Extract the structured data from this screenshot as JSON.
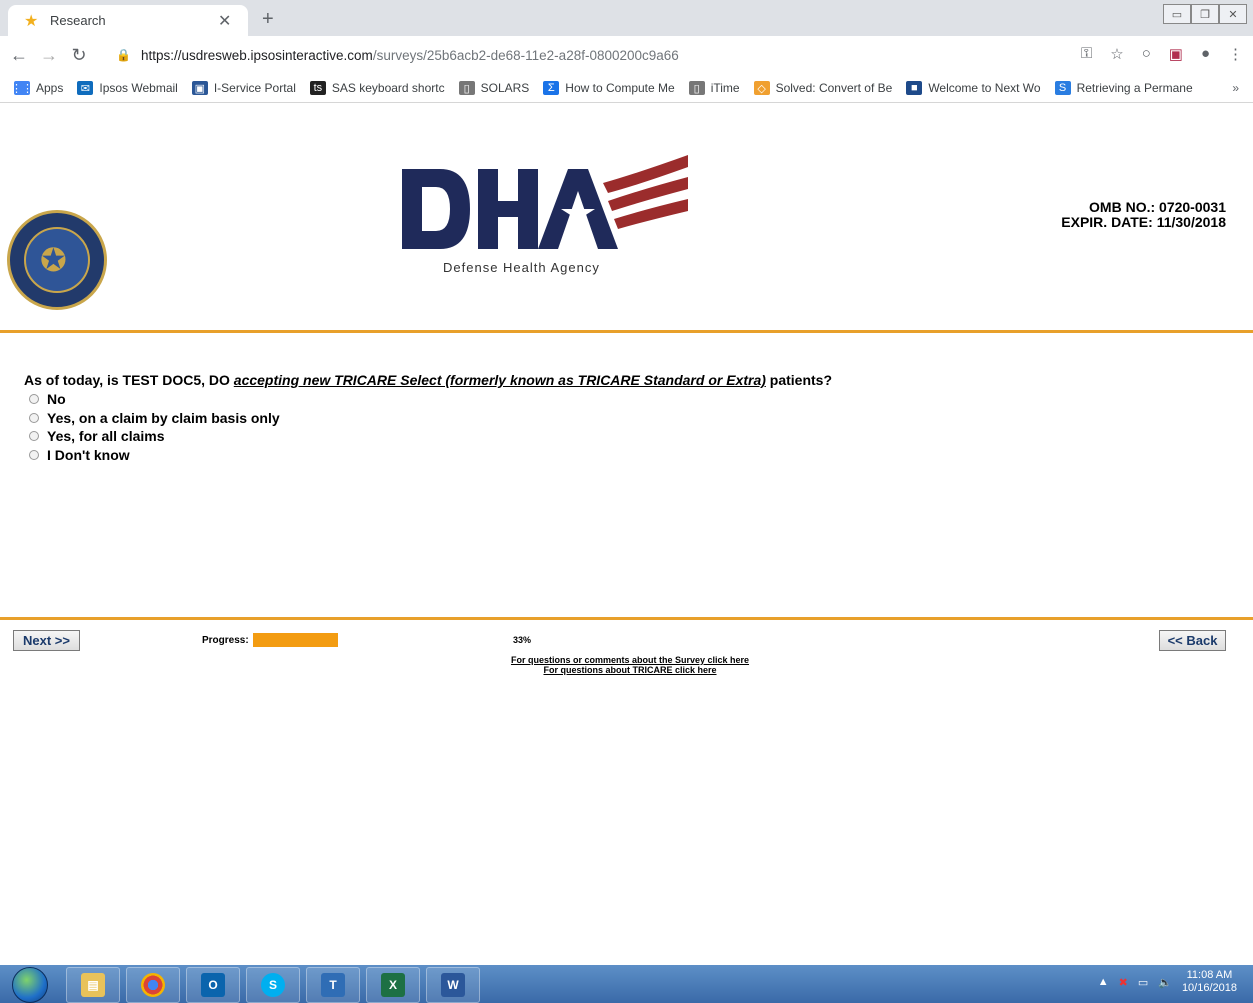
{
  "browser": {
    "tab_title": "Research",
    "url_host": "https://usdresweb.ipsosinteractive.com",
    "url_path": "/surveys/25b6acb2-de68-11e2-a28f-0800200c9a66",
    "bookmarks": [
      {
        "label": "Apps",
        "icon": "apps-grid-icon",
        "color": "#4285f4"
      },
      {
        "label": "Ipsos Webmail",
        "icon": "mail-icon",
        "color": "#0f6cbd"
      },
      {
        "label": "I-Service Portal",
        "icon": "portal-icon",
        "color": "#2b5797"
      },
      {
        "label": "SAS keyboard shortc",
        "icon": "ts-icon",
        "color": "#222"
      },
      {
        "label": "SOLARS",
        "icon": "page-icon",
        "color": "#777"
      },
      {
        "label": "How to Compute Me",
        "icon": "sigma-icon",
        "color": "#1a73e8"
      },
      {
        "label": "iTime",
        "icon": "page-icon",
        "color": "#777"
      },
      {
        "label": "Solved: Convert of Be",
        "icon": "chat-icon",
        "color": "#f0a030"
      },
      {
        "label": "Welcome to Next Wo",
        "icon": "next-icon",
        "color": "#1e4a8a"
      },
      {
        "label": "Retrieving a Permane",
        "icon": "s-icon",
        "color": "#2a7de1"
      }
    ],
    "overflow": "»"
  },
  "header": {
    "logo_caption": "Defense Health Agency",
    "omb_no": "OMB NO.: 0720-0031",
    "expir_date": "EXPIR. DATE: 11/30/2018"
  },
  "question": {
    "prefix": "As of today, is TEST DOC5, DO ",
    "emphasis": "accepting new TRICARE Select (formerly known as TRICARE Standard or Extra)",
    "suffix": " patients?",
    "options": [
      "No",
      "Yes, on a claim by claim basis only",
      "Yes, for all claims",
      "I Don't know"
    ]
  },
  "footer": {
    "next_label": "Next >>",
    "back_label": "<< Back",
    "progress_label": "Progress:",
    "progress_value": 0.33,
    "progress_text": "33%",
    "link_survey": "For questions or comments about the Survey click here",
    "link_tricare": "For questions about TRICARE click here"
  },
  "taskbar": {
    "apps": [
      "file-explorer-icon",
      "chrome-icon",
      "outlook-icon",
      "skype-icon",
      "textpad-icon",
      "excel-icon",
      "word-icon"
    ],
    "time": "11:08 AM",
    "date": "10/16/2018"
  },
  "colors": {
    "accent_rule": "#e8a02a",
    "progress": "#f39c12",
    "dha_navy": "#1f2a5a",
    "dha_red": "#9b2c2c"
  }
}
